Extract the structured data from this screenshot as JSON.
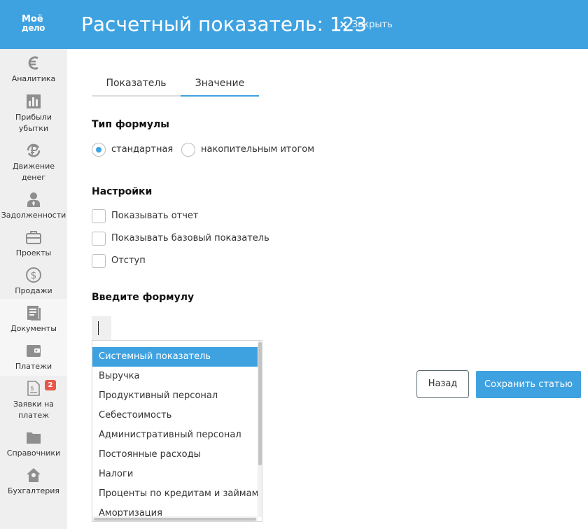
{
  "header": {
    "logo_line1": "Моё",
    "logo_line2": "дело",
    "title": "Расчетный показатель: 123",
    "close_symbol": "×",
    "close_label": "Закрыть"
  },
  "sidebar": {
    "items": [
      {
        "label": "Аналитика",
        "icon": "euro-icon"
      },
      {
        "label": "Прибыли убытки",
        "icon": "bar-chart-icon"
      },
      {
        "label": "Движение денег",
        "icon": "ruble-cycle-icon"
      },
      {
        "label": "Задолженности",
        "icon": "person-tie-icon"
      },
      {
        "label": "Проекты",
        "icon": "briefcase-icon"
      },
      {
        "label": "Продажи",
        "icon": "dollar-coin-icon"
      },
      {
        "label": "Документы",
        "icon": "documents-icon"
      },
      {
        "label": "Платежи",
        "icon": "wallet-icon"
      },
      {
        "label": "Заявки на платеж",
        "icon": "payment-request-icon",
        "badge": "2"
      },
      {
        "label": "Справочники",
        "icon": "folder-icon"
      },
      {
        "label": "Бухгалтерия",
        "icon": "house-icon"
      }
    ]
  },
  "tabs": [
    {
      "label": "Показатель",
      "active": false
    },
    {
      "label": "Значение",
      "active": true
    }
  ],
  "formula_type": {
    "title": "Тип формулы",
    "options": [
      {
        "label": "стандартная",
        "selected": true
      },
      {
        "label": "накопительным итогом",
        "selected": false
      }
    ]
  },
  "settings": {
    "title": "Настройки",
    "options": [
      {
        "label": "Показывать отчет",
        "checked": false
      },
      {
        "label": "Показывать базовый показатель",
        "checked": false
      },
      {
        "label": "Отступ",
        "checked": false
      }
    ]
  },
  "formula": {
    "title": "Введите формулу",
    "value": ""
  },
  "dropdown": {
    "items": [
      "Системный показатель",
      "Выручка",
      "Продуктивный персонал",
      "Себестоимость",
      "Административный персонал",
      "Постоянные расходы",
      "Налоги",
      "Проценты по кредитам и займам",
      "Амортизация"
    ],
    "highlighted_index": 0
  },
  "buttons": {
    "back": "Назад",
    "save": "Сохранить статью"
  },
  "colors": {
    "accent": "#3fa2e0",
    "badge": "#e8574a",
    "sidebar_bg": "#efefef"
  }
}
